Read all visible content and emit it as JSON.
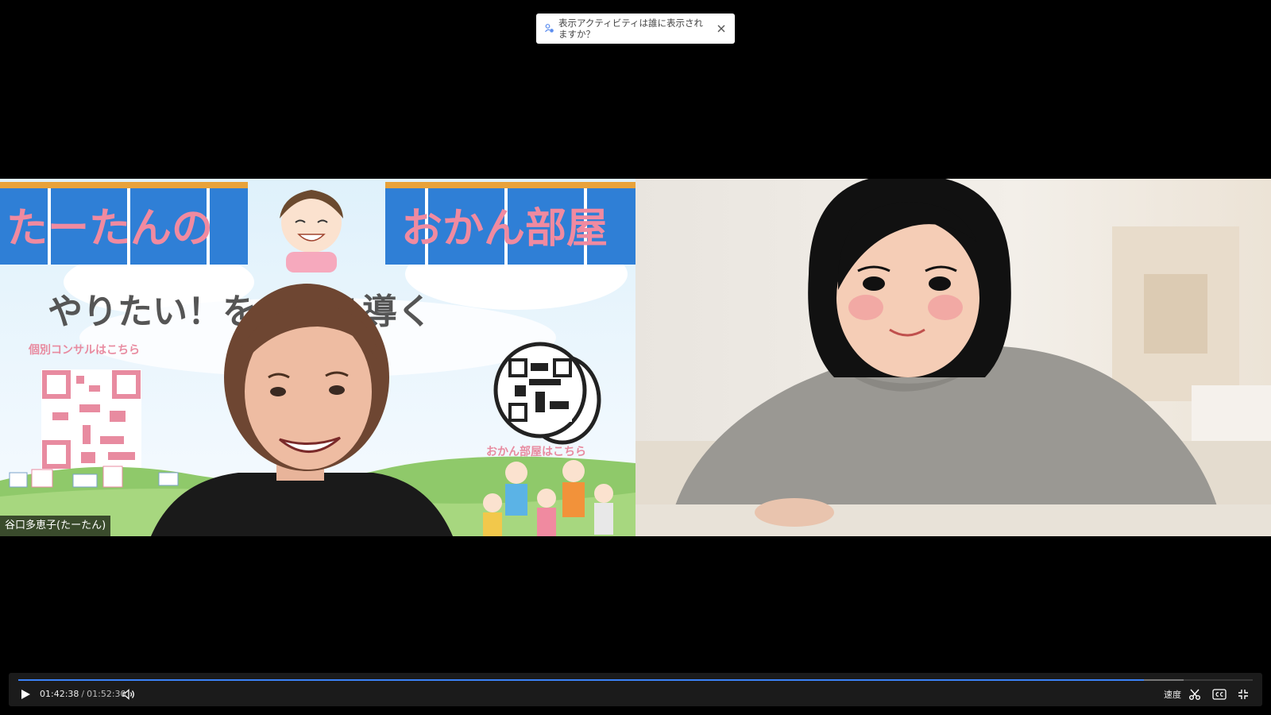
{
  "notice": {
    "text": "表示アクティビティは誰に表示されますか？",
    "icon": "people-icon",
    "close_icon": "close-icon"
  },
  "tiles": [
    {
      "participant_name": "谷口多恵子(たーたん)",
      "slide": {
        "banner_left": "たーたんの",
        "banner_right": "おかん部屋",
        "headline": "やりたい！を一歩を導く",
        "left_label": "個別コンサルはこちら",
        "right_label": "おかん部屋はこちら"
      }
    },
    {
      "participant_name": ""
    }
  ],
  "player": {
    "current_time": "01:42:38",
    "separator": "/",
    "duration": "01:52:30",
    "progress": 0.912,
    "speed_label": "速度",
    "icons": [
      "play-icon",
      "volume-icon",
      "scissors-icon",
      "captions-icon",
      "exit-fullscreen-icon"
    ]
  },
  "colors": {
    "accent": "#3b82f6",
    "banner_blue": "#2f7fd6",
    "banner_text": "#f08aa0"
  }
}
